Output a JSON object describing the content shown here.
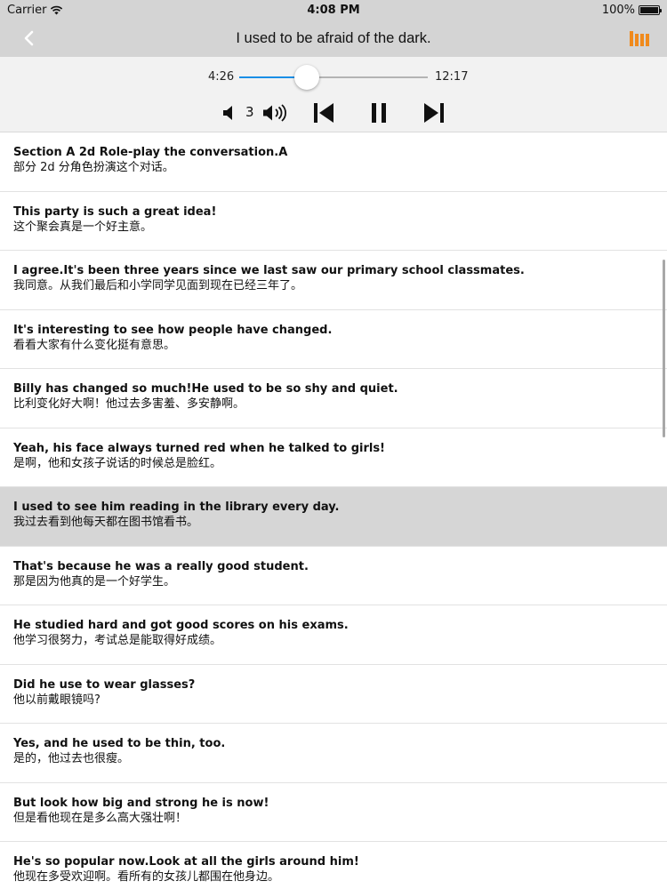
{
  "status": {
    "carrier": "Carrier",
    "time": "4:08 PM",
    "battery": "100%"
  },
  "nav": {
    "title": "I used to be afraid of the dark."
  },
  "player": {
    "current_time": "4:26",
    "total_time": "12:17",
    "progress_fraction": 0.36,
    "volume_level": "3",
    "accent_color": "#1a8fe6"
  },
  "icons": {
    "back": "chevron-left-icon",
    "library": "library-bars-icon",
    "volume_down": "speaker-icon",
    "volume_up": "speaker-waves-icon",
    "previous": "skip-previous-icon",
    "pause": "pause-icon",
    "next": "skip-next-icon"
  },
  "sentences": [
    {
      "en": "Section A 2d Role-play the conversation.A",
      "zh": "部分 2d 分角色扮演这个对话。"
    },
    {
      "en": "This party is such a great idea!",
      "zh": "这个聚会真是一个好主意。"
    },
    {
      "en": "I agree.It's been three years since we last saw our primary school classmates.",
      "zh": "我同意。从我们最后和小学同学见面到现在已经三年了。"
    },
    {
      "en": "It's interesting to see how people have changed.",
      "zh": "看看大家有什么变化挺有意思。"
    },
    {
      "en": "Billy has changed so much!He used to be so shy and quiet.",
      "zh": "比利变化好大啊！他过去多害羞、多安静啊。"
    },
    {
      "en": "Yeah, his face always turned red when he talked to girls!",
      "zh": "是啊，他和女孩子说话的时候总是脸红。"
    },
    {
      "en": "I used to see him reading in the library every day.",
      "zh": "我过去看到他每天都在图书馆看书。"
    },
    {
      "en": "That's because he was a really good student.",
      "zh": "那是因为他真的是一个好学生。"
    },
    {
      "en": "He studied hard and got good scores on his exams.",
      "zh": "他学习很努力，考试总是能取得好成绩。"
    },
    {
      "en": "Did he use to wear glasses?",
      "zh": "他以前戴眼镜吗?"
    },
    {
      "en": "Yes, and he used to be thin, too.",
      "zh": "是的，他过去也很瘦。"
    },
    {
      "en": "But look how big and strong he is now!",
      "zh": "但是看他现在是多么高大强壮啊！"
    },
    {
      "en": "He's so popular now.Look at all the girls around him!",
      "zh": "他现在多受欢迎啊。看所有的女孩儿都围在他身边。"
    }
  ],
  "active_sentence_index": 6
}
